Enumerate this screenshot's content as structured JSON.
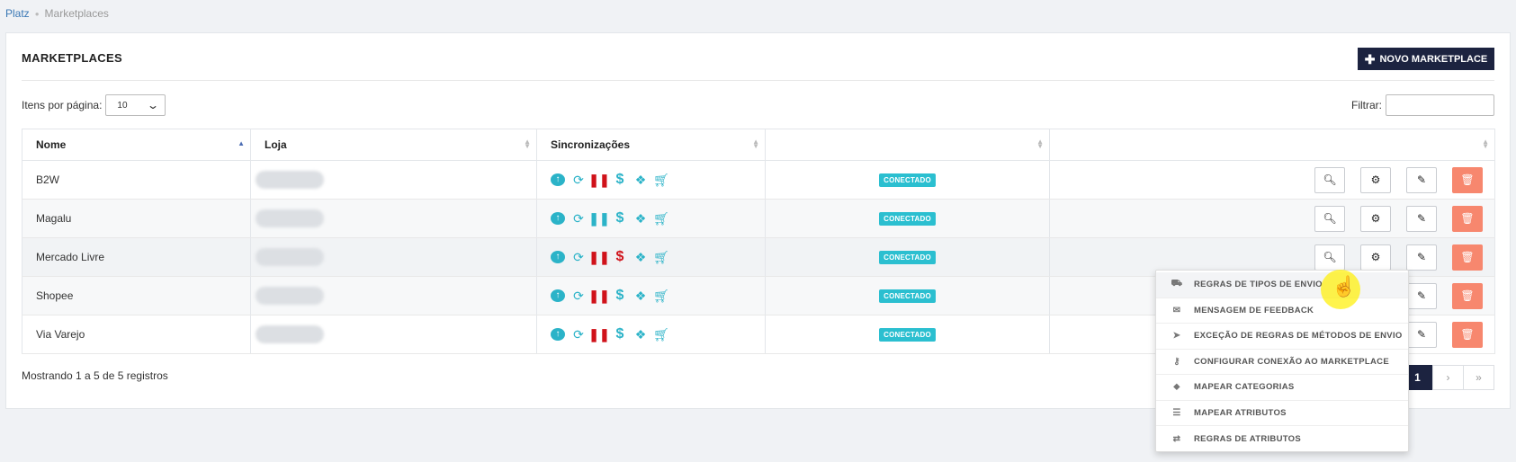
{
  "breadcrumb": {
    "root": "Platz",
    "current": "Marketplaces"
  },
  "card": {
    "title": "MARKETPLACES",
    "new_button": "NOVO MARKETPLACE"
  },
  "controls": {
    "per_page_label": "Itens por página:",
    "per_page_value": "10",
    "filter_label": "Filtrar:",
    "filter_value": ""
  },
  "table": {
    "headers": [
      "Nome",
      "Loja",
      "Sincronizações",
      "",
      ""
    ],
    "rows": [
      {
        "name": "B2W",
        "status": "CONECTADO",
        "pause_color": "#d0121a",
        "dollar_color": "#2bb3c8"
      },
      {
        "name": "Magalu",
        "status": "CONECTADO",
        "pause_color": "#2bb3c8",
        "dollar_color": "#2bb3c8"
      },
      {
        "name": "Mercado Livre",
        "status": "CONECTADO",
        "pause_color": "#d0121a",
        "dollar_color": "#d0121a"
      },
      {
        "name": "Shopee",
        "status": "CONECTADO",
        "pause_color": "#d0121a",
        "dollar_color": "#2bb3c8"
      },
      {
        "name": "Via Varejo",
        "status": "CONECTADO",
        "pause_color": "#d0121a",
        "dollar_color": "#2bb3c8"
      }
    ]
  },
  "footer": {
    "info": "Mostrando 1 a 5 de 5 registros",
    "pages": [
      "1",
      "›",
      "»"
    ]
  },
  "dropdown": {
    "items": [
      {
        "label": "REGRAS DE TIPOS DE ENVIO",
        "icon": "truck-icon",
        "glyph": "⛟"
      },
      {
        "label": "MENSAGEM DE FEEDBACK",
        "icon": "envelope-icon",
        "glyph": "✉"
      },
      {
        "label": "EXCEÇÃO DE REGRAS DE MÉTODOS DE ENVIO",
        "icon": "send-icon",
        "glyph": "➤"
      },
      {
        "label": "CONFIGURAR CONEXÃO AO MARKETPLACE",
        "icon": "key-icon",
        "glyph": "⚷"
      },
      {
        "label": "MAPEAR CATEGORIAS",
        "icon": "tag-icon",
        "glyph": "⬥"
      },
      {
        "label": "MAPEAR ATRIBUTOS",
        "icon": "list-icon",
        "glyph": "☰"
      },
      {
        "label": "REGRAS DE ATRIBUTOS",
        "icon": "exchange-icon",
        "glyph": "⇄"
      }
    ]
  }
}
